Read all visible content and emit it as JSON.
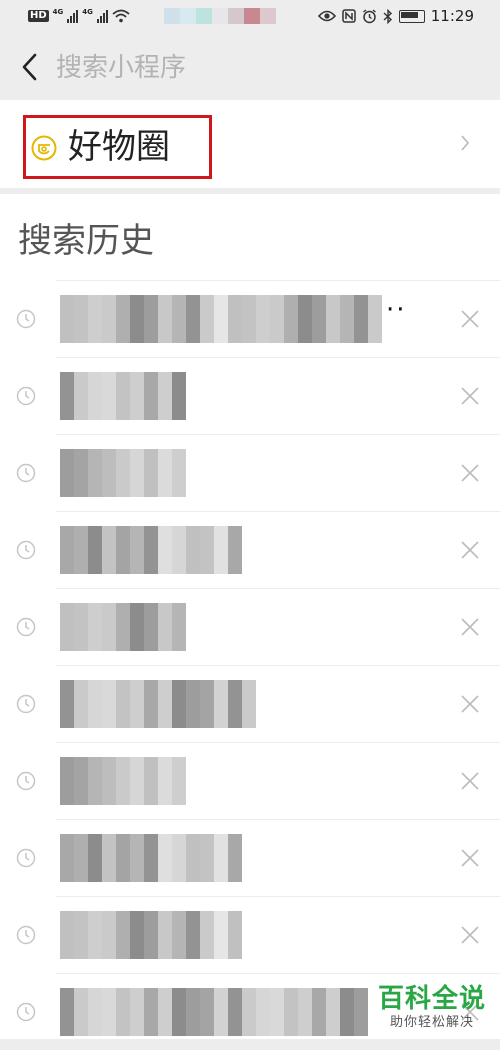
{
  "status_bar": {
    "hd": "HD",
    "net1": "4G",
    "net2": "4G",
    "time": "11:29"
  },
  "header": {
    "search_placeholder": "搜索小程序"
  },
  "result": {
    "title": "好物圈",
    "highlight_color": "#d0171c",
    "icon_color": "#e5b800"
  },
  "history": {
    "title": "搜索历史",
    "items": [
      {
        "text": "",
        "blur_widths": 23
      },
      {
        "text": "",
        "blur_widths": 9
      },
      {
        "text": "",
        "blur_widths": 9
      },
      {
        "text": "",
        "blur_widths": 13
      },
      {
        "text": "",
        "blur_widths": 9
      },
      {
        "text": "",
        "blur_widths": 14
      },
      {
        "text": "",
        "blur_widths": 9
      },
      {
        "text": "",
        "blur_widths": 13
      },
      {
        "text": "",
        "blur_widths": 13
      },
      {
        "text": "",
        "blur_widths": 22
      }
    ]
  },
  "watermark": {
    "main": "百科全说",
    "sub": "助你轻松解决",
    "color": "#2aa745"
  }
}
